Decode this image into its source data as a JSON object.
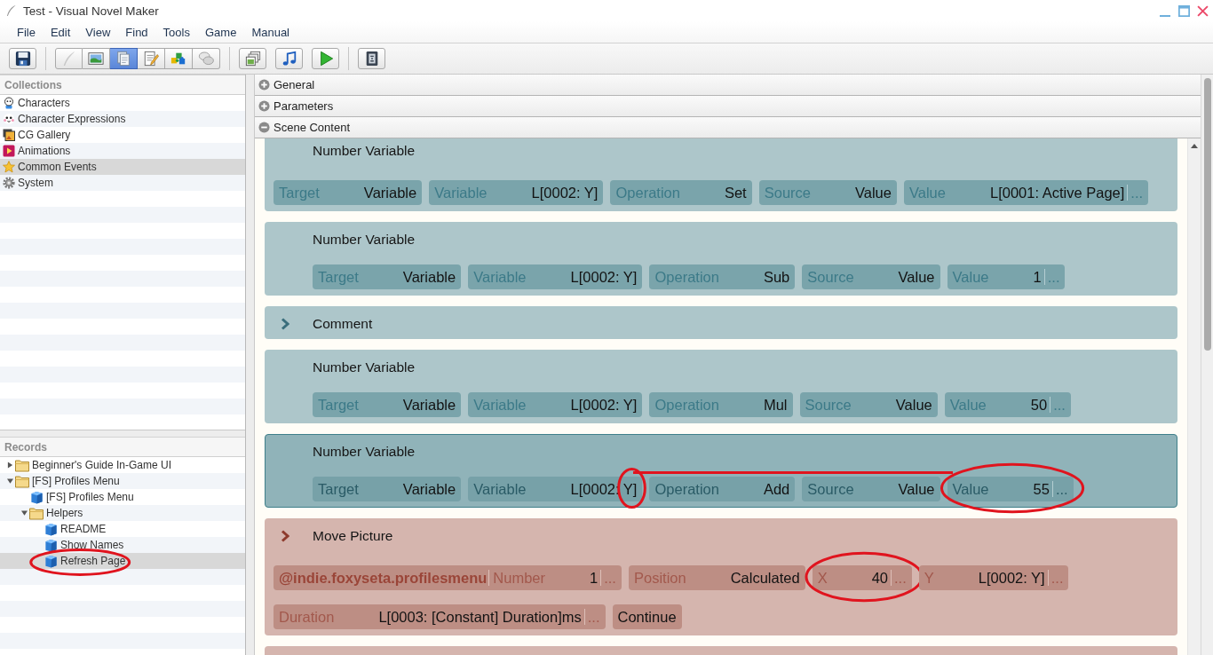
{
  "window": {
    "title": "Test - Visual Novel Maker"
  },
  "menu": [
    "File",
    "Edit",
    "View",
    "Find",
    "Tools",
    "Game",
    "Manual"
  ],
  "toolbar": {
    "groups": [
      {
        "kind": "single",
        "buttons": [
          {
            "selected": false,
            "disabled": false
          }
        ]
      },
      {
        "kind": "segmented",
        "buttons": [
          {
            "selected": false,
            "disabled": true
          },
          {
            "selected": false,
            "disabled": false
          },
          {
            "selected": true,
            "disabled": false
          },
          {
            "selected": false,
            "disabled": false
          },
          {
            "selected": false,
            "disabled": false
          },
          {
            "selected": false,
            "disabled": false
          }
        ]
      },
      {
        "kind": "separate",
        "buttons": [
          {
            "selected": false,
            "disabled": false
          },
          {
            "selected": false,
            "disabled": false
          },
          {
            "selected": false,
            "disabled": false
          }
        ]
      },
      {
        "kind": "single",
        "buttons": [
          {
            "selected": false,
            "disabled": false
          }
        ]
      }
    ]
  },
  "collections": {
    "title": "Collections",
    "items": [
      {
        "label": "Characters",
        "selected": false
      },
      {
        "label": "Character Expressions",
        "selected": false
      },
      {
        "label": "CG Gallery",
        "selected": false
      },
      {
        "label": "Animations",
        "selected": false
      },
      {
        "label": "Common Events",
        "selected": true
      },
      {
        "label": "System",
        "selected": false
      }
    ]
  },
  "records": {
    "title": "Records",
    "tree": [
      {
        "label": "Beginner's Guide In-Game UI",
        "kind": "folder",
        "expanded": false,
        "selected": false,
        "circled": false
      },
      {
        "label": "[FS] Profiles Menu",
        "kind": "folder",
        "expanded": true,
        "selected": false,
        "circled": false,
        "children": [
          {
            "label": "[FS] Profiles Menu",
            "kind": "record",
            "selected": false,
            "circled": false
          },
          {
            "label": "Helpers",
            "kind": "folder",
            "expanded": true,
            "selected": false,
            "circled": false,
            "children": [
              {
                "label": "README",
                "kind": "record",
                "selected": false,
                "circled": false
              },
              {
                "label": "Show Names",
                "kind": "record",
                "selected": false,
                "circled": false
              },
              {
                "label": "Refresh Page",
                "kind": "record",
                "selected": true,
                "circled": true
              }
            ]
          }
        ]
      }
    ]
  },
  "sections": [
    {
      "title": "General",
      "expanded": false
    },
    {
      "title": "Parameters",
      "expanded": false
    },
    {
      "title": "Scene Content",
      "expanded": true,
      "commands": [
        {
          "kind": "number_variable",
          "selected": false,
          "title": "Number Variable",
          "params": [
            {
              "label": "Target",
              "value": "Variable",
              "circled": false,
              "tail_circled": false
            },
            {
              "label": "Variable",
              "value": "L[0002: Y]",
              "circled": false,
              "tail_circled": false
            },
            {
              "label": "Operation",
              "value": "Set",
              "circled": false,
              "tail_circled": false
            },
            {
              "label": "Source",
              "value": "Value",
              "circled": false,
              "tail_circled": false
            },
            {
              "label": "Value",
              "value": "L[0001: Active Page]",
              "more": "...",
              "circled": false,
              "tail_circled": false
            }
          ]
        },
        {
          "kind": "number_variable",
          "selected": false,
          "title": "Number Variable",
          "params": [
            {
              "label": "Target",
              "value": "Variable",
              "circled": false,
              "tail_circled": false
            },
            {
              "label": "Variable",
              "value": "L[0002: Y]",
              "circled": false,
              "tail_circled": false
            },
            {
              "label": "Operation",
              "value": "Sub",
              "circled": false,
              "tail_circled": false
            },
            {
              "label": "Source",
              "value": "Value",
              "circled": false,
              "tail_circled": false
            },
            {
              "label": "Value",
              "value": "1",
              "more": "...",
              "circled": false,
              "tail_circled": false
            }
          ]
        },
        {
          "kind": "comment",
          "selected": false,
          "title": "Comment"
        },
        {
          "kind": "number_variable",
          "selected": false,
          "title": "Number Variable",
          "params": [
            {
              "label": "Target",
              "value": "Variable",
              "circled": false,
              "tail_circled": false
            },
            {
              "label": "Variable",
              "value": "L[0002: Y]",
              "circled": false,
              "tail_circled": false
            },
            {
              "label": "Operation",
              "value": "Mul",
              "circled": false,
              "tail_circled": false
            },
            {
              "label": "Source",
              "value": "Value",
              "circled": false,
              "tail_circled": false
            },
            {
              "label": "Value",
              "value": "50",
              "more": "...",
              "circled": false,
              "tail_circled": false
            }
          ]
        },
        {
          "kind": "number_variable",
          "selected": true,
          "title": "Number Variable",
          "params": [
            {
              "label": "Target",
              "value": "Variable",
              "circled": false,
              "tail_circled": false
            },
            {
              "label": "Variable",
              "value": "L[0002: Y]",
              "circled": false,
              "tail_circled": true
            },
            {
              "label": "Operation",
              "value": "Add",
              "circled": false,
              "tail_circled": false
            },
            {
              "label": "Source",
              "value": "Value",
              "circled": false,
              "tail_circled": false
            },
            {
              "label": "Value",
              "value": "55",
              "more": "...",
              "circled": true,
              "tail_circled": false
            }
          ]
        },
        {
          "kind": "move_picture",
          "selected": false,
          "title": "Move Picture",
          "params": [
            {
              "prefix": "@indie.foxyseta.profilesmenu",
              "label": "Number",
              "value": "1",
              "more": "...",
              "circled": false,
              "tail_circled": false
            },
            {
              "label": "Position",
              "value": "Calculated",
              "circled": false,
              "tail_circled": false
            },
            {
              "label": "X",
              "value": "40",
              "more": "...",
              "circled": true,
              "tail_circled": false
            },
            {
              "label": "Y",
              "value": "L[0002: Y]",
              "more": "...",
              "circled": false,
              "tail_circled": false
            },
            {
              "label": "Duration",
              "value": "L[0003: [Constant] Duration]ms",
              "more": "...",
              "circled": false,
              "tail_circled": false
            },
            {
              "value": "Continue",
              "circled": false,
              "tail_circled": false
            }
          ]
        },
        {
          "kind": "move_picture",
          "selected": false
        }
      ]
    }
  ]
}
